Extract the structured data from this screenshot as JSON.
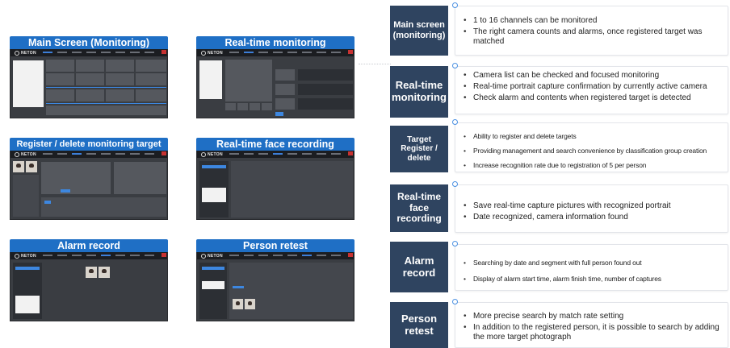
{
  "cards": [
    {
      "title": "Main Screen (Monitoring)",
      "logo": "NETON"
    },
    {
      "title": "Real-time monitoring",
      "logo": "NETON"
    },
    {
      "title": "Register / delete monitoring target",
      "logo": "NETON"
    },
    {
      "title": "Real-time face recording",
      "logo": "NETON"
    },
    {
      "title": "Alarm record",
      "logo": "NETON"
    },
    {
      "title": "Person retest",
      "logo": "NETON"
    }
  ],
  "features": [
    {
      "label": "Main screen (monitoring)",
      "bullets": [
        "1 to 16 channels can be monitored",
        "The right camera counts and alarms, once registered target was matched"
      ]
    },
    {
      "label": "Real-time monitoring",
      "bullets": [
        "Camera list can be checked and focused monitoring",
        "Real-time portrait capture confirmation by currently active camera",
        "Check alarm and contents when registered target is detected"
      ]
    },
    {
      "label": "Target Register / delete",
      "bullets": [
        "Ability to register and delete targets",
        "Providing management and search convenience by classification group creation",
        "Increase recognition rate due to registration of 5 per person"
      ]
    },
    {
      "label": "Real-time face recording",
      "bullets": [
        "Save real-time capture pictures with recognized portrait",
        "Date recognized, camera information found"
      ]
    },
    {
      "label": "Alarm record",
      "bullets": [
        "Searching by date and segment with full person found out",
        "Display of alarm start time, alarm finish time, number of captures"
      ]
    },
    {
      "label": "Person retest",
      "bullets": [
        "More precise search by match rate setting",
        "In addition to the registered person, it is possible to search by adding the more target photograph"
      ]
    }
  ],
  "colors": {
    "card_title_bg": "#1f6fc5",
    "label_bg": "#2f4460",
    "bullet_ring": "#4a90e2"
  }
}
